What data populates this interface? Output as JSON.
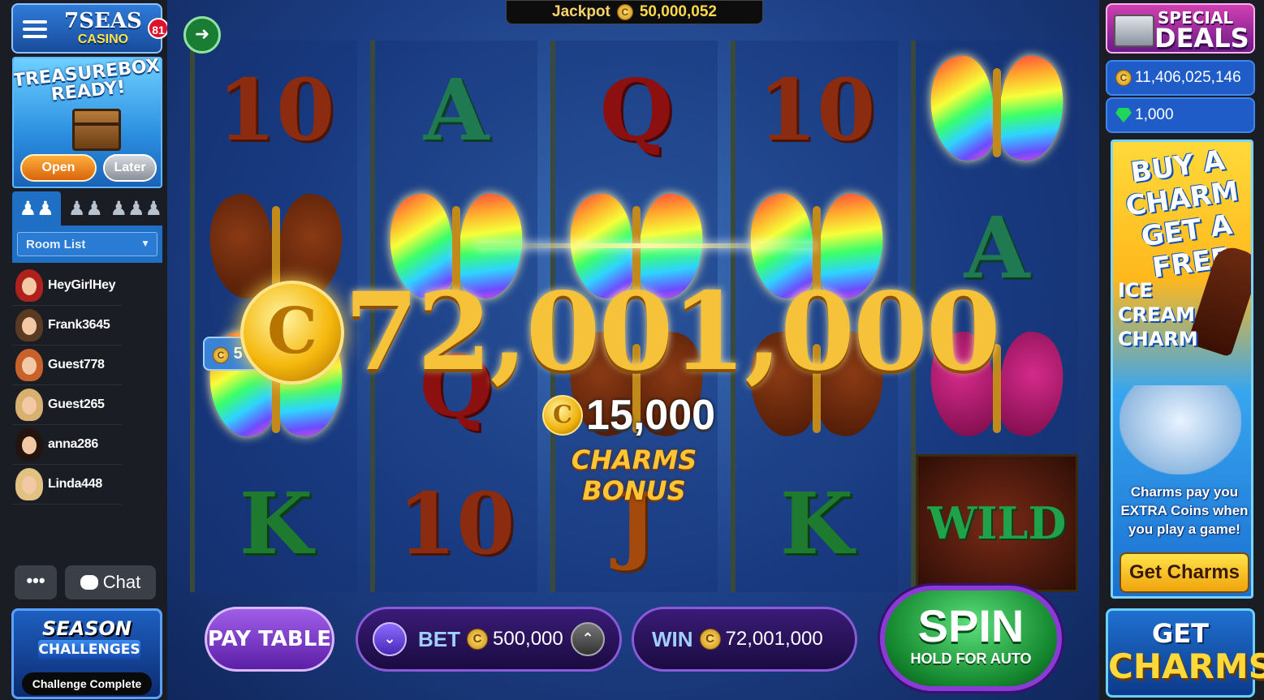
{
  "left": {
    "logo": {
      "line1": "7SEAS",
      "line2": "CASINO"
    },
    "notification_count": "81",
    "treasurebox": {
      "title": "TREASUREBOX READY!",
      "open_label": "Open",
      "later_label": "Later"
    },
    "room_select": "Room List",
    "players": [
      {
        "name": "HeyGirlHey",
        "color": "#b0201c"
      },
      {
        "name": "Frank3645",
        "color": "#5a3a22"
      },
      {
        "name": "Guest778",
        "color": "#c8612a"
      },
      {
        "name": "Guest265",
        "color": "#d8b070"
      },
      {
        "name": "anna286",
        "color": "#241410"
      },
      {
        "name": "Linda448",
        "color": "#e2c280"
      }
    ],
    "more_label": "•••",
    "chat_label": "Chat",
    "season": {
      "title": "SEASON",
      "subtitle": "CHALLENGES",
      "status": "Challenge Complete"
    }
  },
  "game": {
    "jackpot_label": "Jackpot",
    "jackpot_value": "50,000,052",
    "big_win": "72,001,000",
    "sub_win": "15,000",
    "bonus_label": "CHARMS BONUS",
    "badge_value": "5",
    "paytable_label": "PAY TABLE",
    "bet_label": "BET",
    "bet_value": "500,000",
    "win_label": "WIN",
    "win_value": "72,001,000",
    "spin_label": "SPIN",
    "spin_sub": "HOLD FOR AUTO",
    "reels": [
      [
        "10",
        "butterfly-brown",
        "butterfly-rainbow",
        "K"
      ],
      [
        "A",
        "butterfly-rainbow",
        "Q",
        "10"
      ],
      [
        "Q",
        "butterfly-rainbow",
        "butterfly-brown",
        "J"
      ],
      [
        "10",
        "butterfly-rainbow",
        "butterfly-brown",
        "K"
      ],
      [
        "butterfly-rainbow",
        "A",
        "butterfly-pink",
        "WILD"
      ]
    ]
  },
  "right": {
    "deals_top": "SPECIAL",
    "deals_bottom": "DEALS",
    "coins": "11,406,025,146",
    "gems": "1,000",
    "ad": {
      "headline": "BUY A CHARM GET A FREE",
      "product": "ICE CREAM CHARM",
      "copy": "Charms pay you EXTRA Coins when you play a game!",
      "button": "Get Charms"
    },
    "get_charms_top": "GET",
    "get_charms_bottom": "CHARMS"
  },
  "colors": {
    "accent": "#1f6fc5",
    "spin": "#14862e",
    "gold": "#f6c23a"
  }
}
